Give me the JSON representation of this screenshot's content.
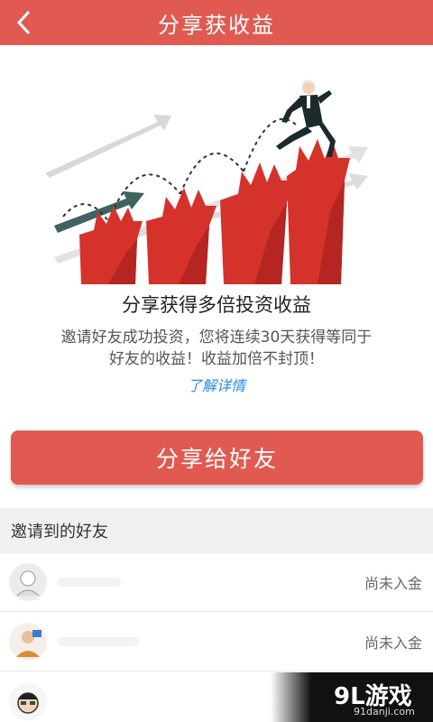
{
  "header": {
    "title": "分享获收益",
    "back_icon": "chevron-left-icon"
  },
  "promo": {
    "headline": "分享获得多倍投资收益",
    "desc_line1": "邀请好友成功投资，您将连续30天获得等同于",
    "desc_line2": "好友的收益！收益加倍不封顶！",
    "learn_more": "了解详情"
  },
  "share_button": "分享给好友",
  "friends": {
    "title": "邀请到的好友",
    "items": [
      {
        "status": "尚未入金"
      },
      {
        "status": "尚未入金"
      },
      {
        "status": ""
      }
    ]
  },
  "watermark": {
    "main": "9L游戏",
    "sub": "91danji.com"
  },
  "colors": {
    "brand": "#e05a52",
    "link": "#2a8be0"
  }
}
